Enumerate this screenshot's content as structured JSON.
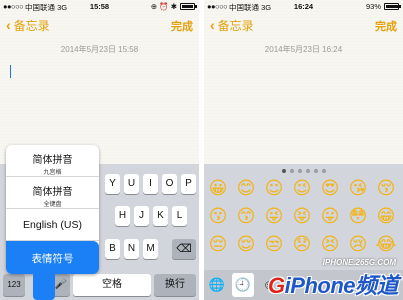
{
  "left": {
    "status": {
      "signal": "●●○○○",
      "carrier": "中国联通",
      "network": "3G",
      "time": "15:58",
      "icons": "⊕ ⏰ ✱"
    },
    "nav": {
      "back_label": "备忘录",
      "done_label": "完成"
    },
    "note_date": "2014年5月23日 15:58",
    "keyboard": {
      "row1": [
        "Y",
        "U",
        "I",
        "O",
        "P"
      ],
      "row2": [
        "H",
        "J",
        "K",
        "L"
      ],
      "row3": [
        "B",
        "N",
        "M"
      ],
      "num_key": "123",
      "space_label": "空格",
      "return_label": "换行"
    },
    "input_menu": {
      "options": [
        {
          "label": "简体拼音",
          "sub": "九宫格"
        },
        {
          "label": "简体拼音",
          "sub": "全键盘"
        },
        {
          "label": "English (US)",
          "sub": ""
        },
        {
          "label": "表情符号",
          "sub": ""
        }
      ],
      "selected_index": 3
    }
  },
  "right": {
    "status": {
      "signal": "●●○○○",
      "carrier": "中国联通",
      "network": "3G",
      "time": "16:24",
      "battery": "93%"
    },
    "nav": {
      "back_label": "备忘录",
      "done_label": "完成"
    },
    "note_date": "2014年5月23日 16:24",
    "emoji_page_count": 6,
    "emoji_active_page": 0,
    "emoji_rows": [
      [
        "😀",
        "😊",
        "☺",
        "😉",
        "😍",
        "😘",
        "😚"
      ],
      [
        "😗",
        "😙",
        "😜",
        "😝",
        "😛",
        "😳",
        "😁"
      ],
      [
        "😔",
        "😌",
        "😒",
        "😞",
        "😣",
        "😢",
        "😂"
      ]
    ],
    "emoji_bar": [
      "🌐",
      "🕘",
      "☺"
    ]
  },
  "watermark": {
    "site": "IPHONE.265G.COM",
    "logo_g": "G",
    "logo_rest": "iPhone频道"
  },
  "colors": {
    "accent": "#e3a20c",
    "selection": "#1b7ff5",
    "keyboard_bg": "#d2d5db"
  }
}
